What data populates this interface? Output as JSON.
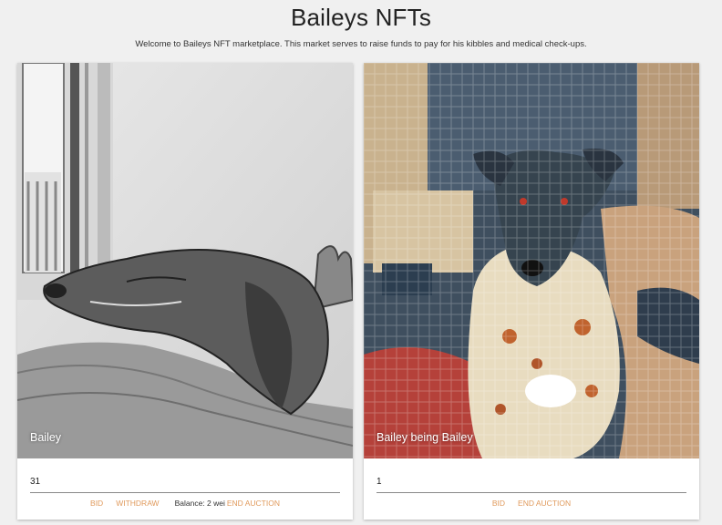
{
  "header": {
    "title": "Baileys NFTs",
    "subtitle": "Welcome to Baileys NFT marketplace. This market serves to raise funds to pay for his kibbles and medical check-ups."
  },
  "cards": [
    {
      "title": "Bailey",
      "bid_value": "31",
      "actions": {
        "bid": "BID",
        "withdraw": "WITHDRAW",
        "end_auction": "END AUCTION"
      },
      "balance": "Balance: 2 wei"
    },
    {
      "title": "Bailey being Bailey",
      "bid_value": "1",
      "actions": {
        "bid": "BID",
        "end_auction": "END AUCTION"
      }
    }
  ],
  "colors": {
    "accent": "#e09a5c",
    "background": "#f0f0f0"
  }
}
